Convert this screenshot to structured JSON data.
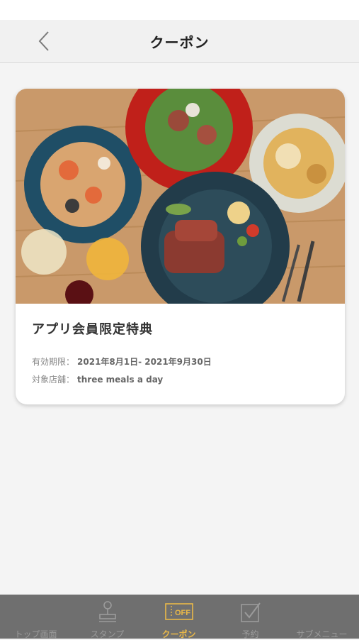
{
  "header": {
    "title": "クーポン"
  },
  "coupon": {
    "title": "アプリ会員限定特典",
    "period_label": "有効期限：",
    "period_value": "2021年8月1日- 2021年9月30日",
    "store_label": "対象店舗：",
    "store_value": "three meals a day"
  },
  "tabs": [
    {
      "label": "トップ画面",
      "icon": "home-icon"
    },
    {
      "label": "スタンプ",
      "icon": "stamp-icon"
    },
    {
      "label": "クーポン",
      "icon": "coupon-off-icon",
      "badge": "OFF"
    },
    {
      "label": "予約",
      "icon": "checkbox-icon"
    },
    {
      "label": "サブメニュー",
      "icon": "menu-icon"
    }
  ],
  "colors": {
    "accent": "#e9b849",
    "tab_bar": "#6f6f6f",
    "inactive": "#9b9b9b"
  }
}
